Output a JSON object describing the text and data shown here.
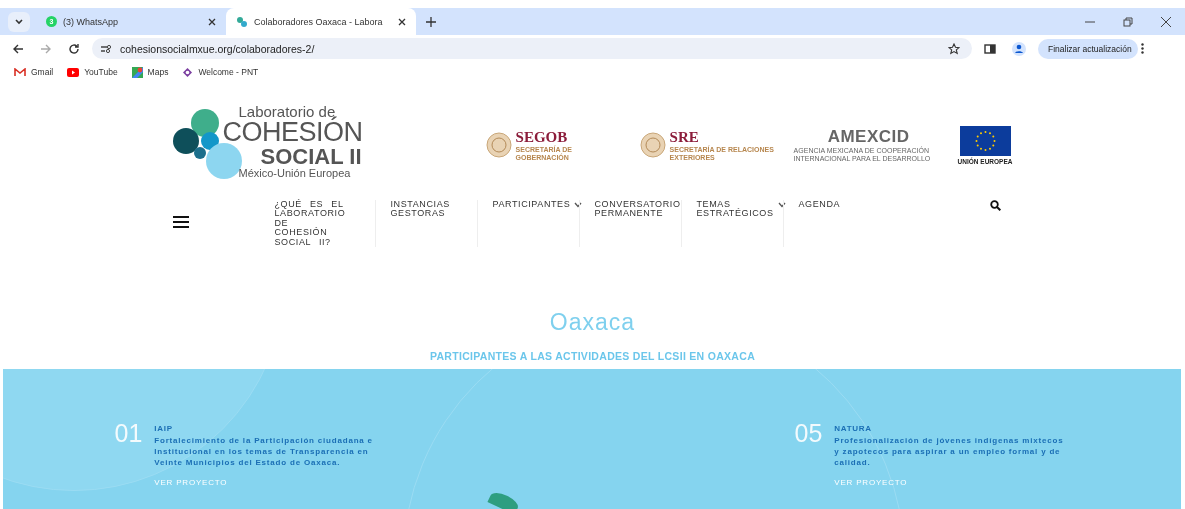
{
  "browser": {
    "tabs": [
      {
        "title": "(3) WhatsApp",
        "badge": "3",
        "kind": "whatsapp",
        "selected": false
      },
      {
        "title": "Colaboradores Oaxaca - Labora",
        "kind": "site",
        "selected": true
      }
    ],
    "url": "cohesionsocialmxue.org/colaboradores-2/",
    "update_button": "Finalizar actualización",
    "bookmarks": [
      {
        "label": "Gmail",
        "kind": "gmail"
      },
      {
        "label": "YouTube",
        "kind": "youtube"
      },
      {
        "label": "Maps",
        "kind": "maps"
      },
      {
        "label": "Welcome - PNT",
        "kind": "pnt"
      }
    ]
  },
  "logo": {
    "line1": "Laboratorio de",
    "line2": "COHESIÓN",
    "line3": "SOCIAL II",
    "line4": "México-Unión Europea"
  },
  "partners": [
    {
      "kind": "seal",
      "name": "SEGOB",
      "sub": "SECRETARÍA DE GOBERNACIÓN"
    },
    {
      "kind": "seal",
      "name": "SRE",
      "sub": "SECRETARÍA DE RELACIONES EXTERIORES"
    },
    {
      "kind": "agency",
      "name": "AMEXCID",
      "sub": "AGENCIA MEXICANA DE COOPERACIÓN INTERNACIONAL PARA EL DESARROLLO"
    },
    {
      "kind": "flag",
      "sub": "UNIÓN EUROPEA"
    }
  ],
  "nav": [
    {
      "label": "¿QUÉ ES EL LABORATORIO DE COHESIÓN SOCIAL II?",
      "dropdown": false
    },
    {
      "label": "INSTANCIAS GESTORAS",
      "dropdown": false
    },
    {
      "label": "PARTICIPANTES",
      "dropdown": true
    },
    {
      "label": "CONVERSATORIO PERMANENTE",
      "dropdown": false
    },
    {
      "label": "TEMAS ESTRATÉGICOS",
      "dropdown": true
    },
    {
      "label": "AGENDA",
      "dropdown": false
    }
  ],
  "page_title": "Oaxaca",
  "subtitle": "PARTICIPANTES A LAS ACTIVIDADES DEL LCSII EN OAXACA",
  "projects": [
    {
      "number": "01",
      "name": "IAIP",
      "description": "Fortalecimiento de la Participación ciudadana e Institucional en los temas de Transparencia en Veinte Municipios del Estado de Oaxaca.",
      "link": "VER PROYECTO"
    },
    {
      "number": "05",
      "name": "NATURA",
      "description": "Profesionalización de jóvenes indígenas mixtecos y zapotecos para aspirar a un empleo formal y de calidad.",
      "link": "VER PROYECTO"
    }
  ]
}
